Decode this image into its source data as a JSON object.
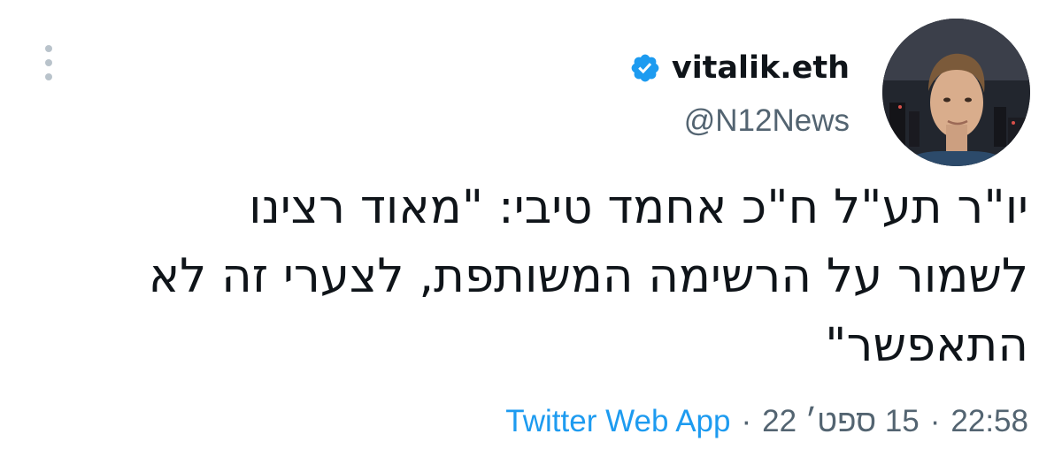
{
  "tweet": {
    "display_name": "vitalik.eth",
    "handle": "@N12News",
    "text_lines": [
      "יו\"ר תע\"ל ח\"כ אחמד טיבי: \"מאוד רצינו",
      "לשמור על הרשימה המשותפת, לצערי זה לא",
      "התאפשר\""
    ],
    "source": "Twitter Web App",
    "separator": "·",
    "date": "15 ספט׳ 22",
    "time": "22:58"
  },
  "icons": {
    "more": "more-vertical-icon",
    "verified": "verified-badge-icon"
  },
  "colors": {
    "verified_blue": "#1d9bf0",
    "source_link": "#1d9bf0",
    "secondary_text": "#536471",
    "primary_text": "#0f1419"
  }
}
